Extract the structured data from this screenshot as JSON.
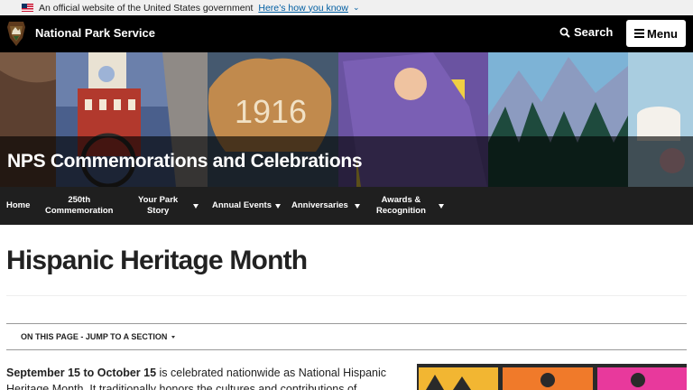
{
  "gov_banner": {
    "text": "An official website of the United States government",
    "link": "Here’s how you know",
    "chevron": "⌄"
  },
  "header": {
    "site_name": "National Park Service",
    "search_label": "Search",
    "menu_label": "Menu"
  },
  "hero": {
    "title": "NPS Commemorations and Celebrations",
    "year_text": "1916"
  },
  "subnav": {
    "items": [
      {
        "line1": "Home",
        "line2": ""
      },
      {
        "line1": "250th",
        "line2": "Commemoration"
      },
      {
        "line1": "Your Park",
        "line2": "Story"
      },
      {
        "line1": "Annual Events",
        "line2": ""
      },
      {
        "line1": "Anniversaries",
        "line2": ""
      },
      {
        "line1": "Awards &",
        "line2": "Recognition"
      }
    ]
  },
  "main": {
    "title": "Hispanic Heritage Month",
    "jump_label": "ON THIS PAGE - JUMP TO A SECTION",
    "intro_bold": "September 15 to October 15",
    "intro_rest": " is celebrated nationwide as National Hispanic Heritage Month. It traditionally honors the cultures and contributions of"
  },
  "colors": {
    "header_bg": "#000000",
    "subnav_bg": "#1f1f1f",
    "gov_banner_bg": "#f0f0f0",
    "link": "#005ea2"
  }
}
